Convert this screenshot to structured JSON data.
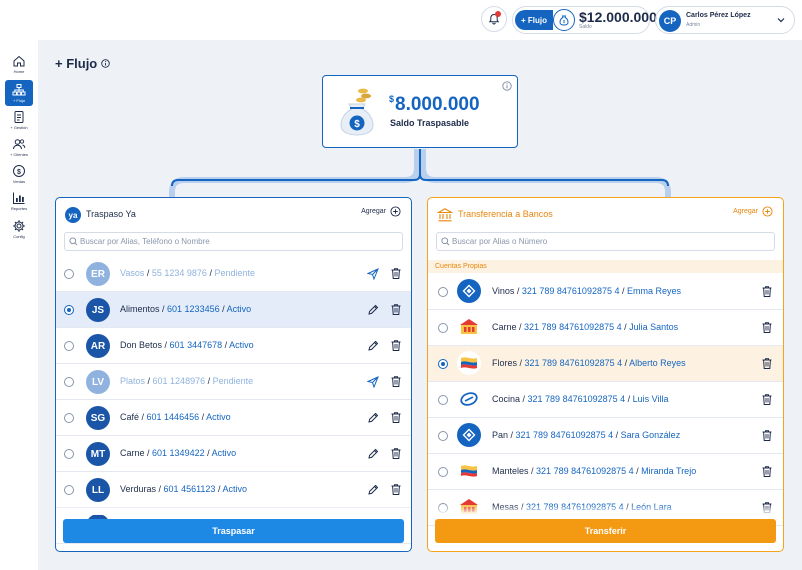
{
  "topbar": {
    "flujo_button": "+ Flujo",
    "balance_amount": "$12.000.000",
    "balance_label": "Saldo",
    "user_initials": "CP",
    "user_name": "Carlos Pérez López",
    "user_role": "Admin"
  },
  "sidebar": {
    "items": [
      {
        "label": "Home",
        "icon": "home-icon"
      },
      {
        "label": "+ Flujo",
        "icon": "flow-icon",
        "active": true
      },
      {
        "label": "+ Gestión",
        "icon": "document-icon"
      },
      {
        "label": "+ Clientes",
        "icon": "clients-icon"
      },
      {
        "label": "Ventas",
        "icon": "dollar-icon"
      },
      {
        "label": "Reportes",
        "icon": "report-icon"
      },
      {
        "label": "Config",
        "icon": "gear-icon"
      }
    ]
  },
  "page": {
    "title": "+ Flujo"
  },
  "center_card": {
    "currency": "$",
    "amount": "8.000.000",
    "label": "Saldo Traspasable"
  },
  "left_panel": {
    "logo": "ya",
    "title": "Traspaso Ya",
    "add_label": "Agregar",
    "search_placeholder": "Buscar por Alias, Teléfono o Nombre",
    "rows": [
      {
        "initials": "ER",
        "name": "Vasos",
        "number": "55 1234 9876",
        "status": "Pendiente",
        "pending": true,
        "selected": false
      },
      {
        "initials": "JS",
        "name": "Alimentos",
        "number": "601 1233456",
        "status": "Activo",
        "pending": false,
        "selected": true
      },
      {
        "initials": "AR",
        "name": "Don Betos",
        "number": "601 3447678",
        "status": "Activo",
        "pending": false,
        "selected": false
      },
      {
        "initials": "LV",
        "name": "Platos",
        "number": "601 1248976",
        "status": "Pendiente",
        "pending": true,
        "selected": false
      },
      {
        "initials": "SG",
        "name": "Café",
        "number": "601 1446456",
        "status": "Activo",
        "pending": false,
        "selected": false
      },
      {
        "initials": "MT",
        "name": "Carne",
        "number": "601 1349422",
        "status": "Activo",
        "pending": false,
        "selected": false
      },
      {
        "initials": "LL",
        "name": "Verduras",
        "number": "601 4561123",
        "status": "Activo",
        "pending": false,
        "selected": false
      }
    ],
    "button_label": "Traspasar"
  },
  "right_panel": {
    "title": "Transferencia a Bancos",
    "add_label": "Agregar",
    "search_placeholder": "Buscar por Alias o Número",
    "group_label": "Cuentas Propias",
    "rows": [
      {
        "bank": "diamond",
        "name": "Vinos",
        "account": "321 789 84761092875 4",
        "holder": "Emma Reyes",
        "selected": false
      },
      {
        "bank": "bank-red",
        "name": "Carne",
        "account": "321 789 84761092875 4",
        "holder": "Julia Santos",
        "selected": false
      },
      {
        "bank": "flag",
        "name": "Flores",
        "account": "321 789 84761092875 4",
        "holder": "Alberto Reyes",
        "selected": true
      },
      {
        "bank": "oval",
        "name": "Cocina",
        "account": "321 789 84761092875 4",
        "holder": "Luis Villa",
        "selected": false
      },
      {
        "bank": "diamond",
        "name": "Pan",
        "account": "321 789 84761092875 4",
        "holder": "Sara González",
        "selected": false
      },
      {
        "bank": "flag",
        "name": "Manteles",
        "account": "321 789 84761092875 4",
        "holder": "Miranda Trejo",
        "selected": false
      },
      {
        "bank": "bank-red",
        "name": "Mesas",
        "account": "321 789 84761092875 4",
        "holder": "León Lara",
        "selected": false
      }
    ],
    "button_label": "Transferir"
  },
  "colors": {
    "primary": "#1565c0",
    "accent": "#f39a12",
    "pending": "#8fb2de"
  }
}
